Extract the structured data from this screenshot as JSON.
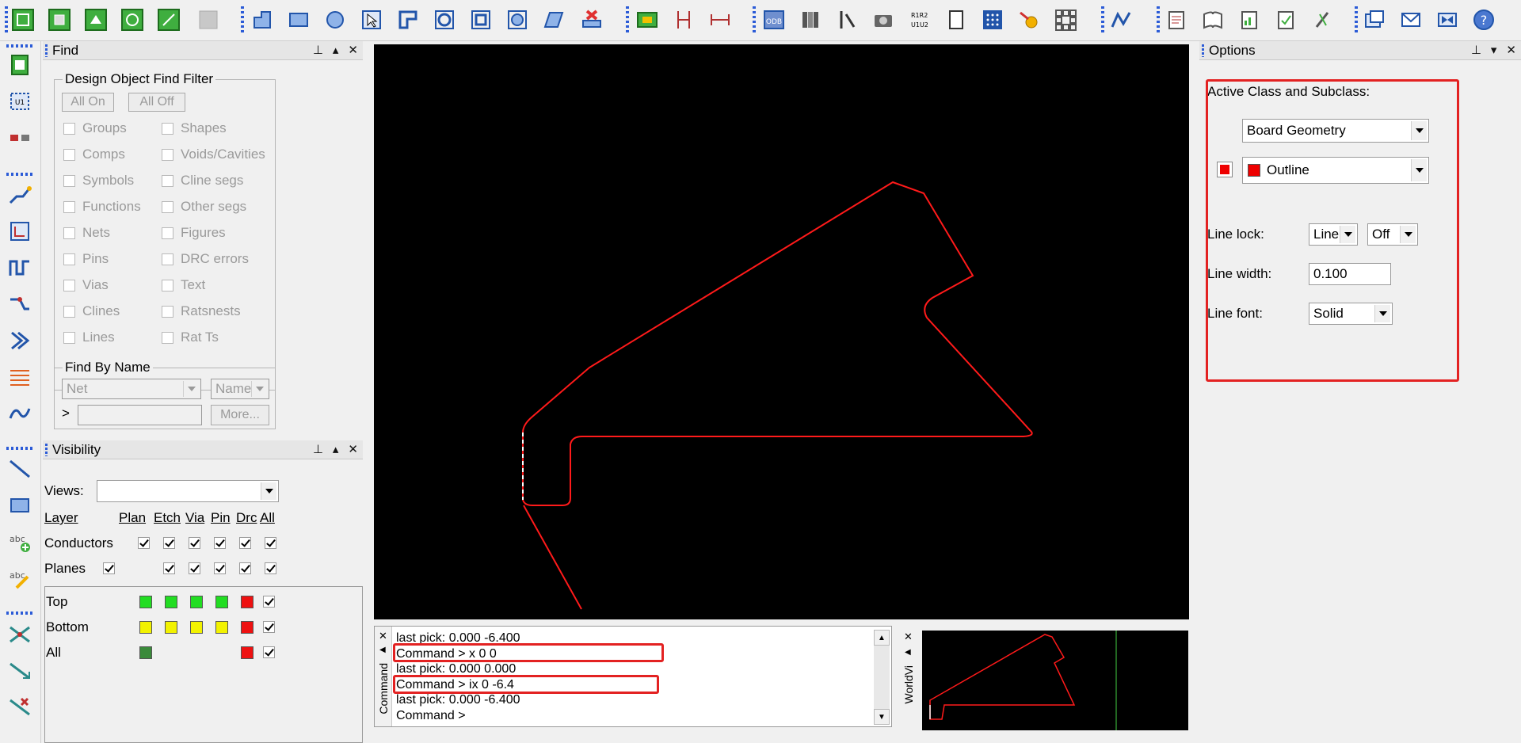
{
  "find_panel": {
    "title": "Find",
    "filter_group": "Design Object Find Filter",
    "all_on": "All On",
    "all_off": "All Off",
    "left_items": [
      "Groups",
      "Comps",
      "Symbols",
      "Functions",
      "Nets",
      "Pins",
      "Vias",
      "Clines",
      "Lines"
    ],
    "right_items": [
      "Shapes",
      "Voids/Cavities",
      "Cline segs",
      "Other segs",
      "Figures",
      "DRC errors",
      "Text",
      "Ratsnests",
      "Rat Ts"
    ],
    "find_by_name": "Find By Name",
    "type_value": "Net",
    "name_value": "Name",
    "prompt": ">",
    "more": "More..."
  },
  "visibility_panel": {
    "title": "Visibility",
    "views_label": "Views:",
    "headers": [
      "Layer",
      "Plan",
      "Etch",
      "Via",
      "Pin",
      "Drc",
      "All"
    ],
    "rows": [
      {
        "label": "Conductors"
      },
      {
        "label": "Planes"
      }
    ],
    "layer_rows": [
      {
        "label": "Top",
        "color": "#22dd22"
      },
      {
        "label": "Bottom",
        "color": "#f2f200"
      },
      {
        "label": "All",
        "color": "#3a8a3a"
      }
    ],
    "drc_color": "#ee1111"
  },
  "options_panel": {
    "title": "Options",
    "active_class_label": "Active Class and Subclass:",
    "class_value": "Board Geometry",
    "subclass_value": "Outline",
    "subclass_color": "#ee0000",
    "line_lock_label": "Line lock:",
    "line_lock_value": "Line",
    "line_lock_angle": "Off",
    "line_width_label": "Line width:",
    "line_width_value": "0.100",
    "line_font_label": "Line font:",
    "line_font_value": "Solid"
  },
  "command_panel": {
    "title": "Command",
    "lines": [
      "last pick:  0.000  -6.400",
      "Command > x 0 0",
      "last pick:  0.000  0.000",
      "Command > ix 0 -6.4",
      "last pick:  0.000  -6.400",
      "Command >"
    ]
  },
  "worldview_panel": {
    "title": "WorldVi"
  },
  "colors": {
    "outline": "#ff1a1a",
    "canvas": "#000000",
    "highlight": "#e32222",
    "grip": "#2b5bd7"
  }
}
